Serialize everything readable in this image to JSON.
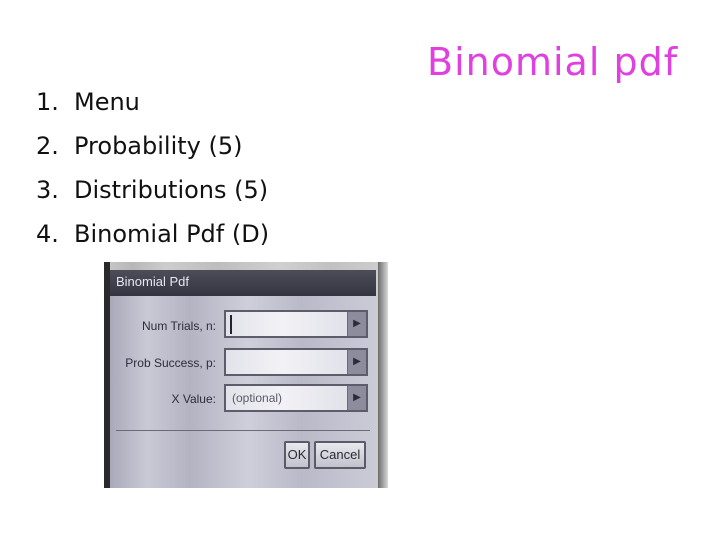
{
  "slide": {
    "title": "Binomial pdf",
    "title_color": "#e040e0",
    "steps": [
      {
        "number": "1.",
        "text": "Menu"
      },
      {
        "number": "2.",
        "text": "Probability (5)"
      },
      {
        "number": "3.",
        "text": "Distributions (5)"
      },
      {
        "number": "4.",
        "text": "Binomial Pdf (D)"
      }
    ]
  },
  "dialog": {
    "title": "Binomial Pdf",
    "fields": [
      {
        "label": "Num Trials, n:",
        "value": "",
        "placeholder": ""
      },
      {
        "label": "Prob Success, p:",
        "value": "",
        "placeholder": ""
      },
      {
        "label": "X Value:",
        "value": "",
        "placeholder": "(optional)"
      }
    ],
    "buttons": {
      "ok": "OK",
      "cancel": "Cancel"
    },
    "icons": {
      "field_arrow": "chevron-right-icon",
      "cursor": "text-cursor"
    }
  }
}
